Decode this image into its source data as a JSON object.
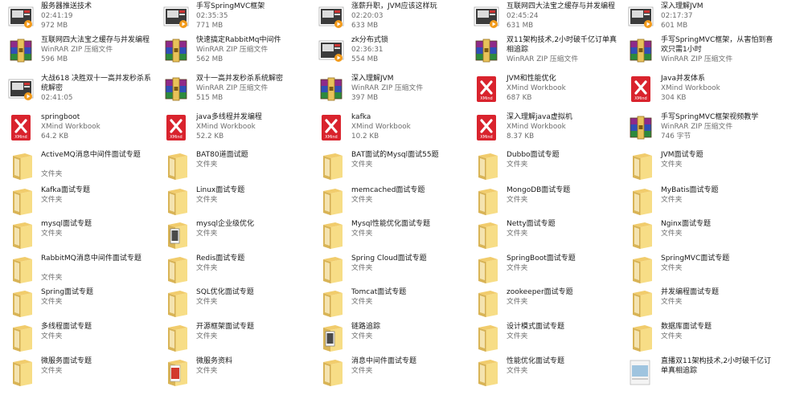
{
  "columns": [
    [
      {
        "name": "服务器推送技术",
        "lines": [
          "02:41:19",
          "972 MB"
        ],
        "icon": "video-file-icon"
      },
      {
        "name": "互联网四大法宝之缓存与并发编程",
        "lines": [
          "WinRAR ZIP 压缩文件",
          "596 MB"
        ],
        "icon": "winrar-archive-icon"
      },
      {
        "name": "大战618 决胜双十一高并发秒杀系统解密",
        "lines": [
          "02:41:05"
        ],
        "icon": "video-file-icon"
      },
      {
        "name": "springboot",
        "lines": [
          "XMind Workbook",
          "64.2 KB"
        ],
        "icon": "xmind-file-icon"
      },
      {
        "name": "ActiveMQ消息中间件面试专题",
        "lines": [
          "文件夹"
        ],
        "icon": "folder-icon"
      },
      {
        "name": "Kafka面试专题",
        "lines": [
          "文件夹"
        ],
        "icon": "folder-icon"
      },
      {
        "name": "mysql面试专题",
        "lines": [
          "文件夹"
        ],
        "icon": "folder-icon"
      },
      {
        "name": "RabbitMQ消息中间件面试专题",
        "lines": [
          "文件夹"
        ],
        "icon": "folder-icon"
      },
      {
        "name": "Spring面试专题",
        "lines": [
          "文件夹"
        ],
        "icon": "folder-icon"
      },
      {
        "name": "多线程面试专题",
        "lines": [
          "文件夹"
        ],
        "icon": "folder-icon"
      },
      {
        "name": "微服务面试专题",
        "lines": [
          "文件夹"
        ],
        "icon": "folder-icon"
      }
    ],
    [
      {
        "name": "手写SpringMVC框架",
        "lines": [
          "02:35:35",
          "771 MB"
        ],
        "icon": "video-file-icon"
      },
      {
        "name": "快速搞定RabbitMq中间件",
        "lines": [
          "WinRAR ZIP 压缩文件",
          "562 MB"
        ],
        "icon": "winrar-archive-icon"
      },
      {
        "name": "双十一高并发秒杀系统解密",
        "lines": [
          "WinRAR ZIP 压缩文件",
          "515 MB"
        ],
        "icon": "winrar-archive-icon"
      },
      {
        "name": "java多线程并发编程",
        "lines": [
          "XMind Workbook",
          "52.2 KB"
        ],
        "icon": "xmind-file-icon"
      },
      {
        "name": "BAT80道面试题",
        "lines": [
          "文件夹"
        ],
        "icon": "folder-icon"
      },
      {
        "name": "Linux面试专题",
        "lines": [
          "文件夹"
        ],
        "icon": "folder-icon"
      },
      {
        "name": "mysql企业级优化",
        "lines": [
          "文件夹"
        ],
        "icon": "folder-doc-icon"
      },
      {
        "name": "Redis面试专题",
        "lines": [
          "文件夹"
        ],
        "icon": "folder-icon"
      },
      {
        "name": "SQL优化面试专题",
        "lines": [
          "文件夹"
        ],
        "icon": "folder-icon"
      },
      {
        "name": "开源框架面试专题",
        "lines": [
          "文件夹"
        ],
        "icon": "folder-icon"
      },
      {
        "name": "微服务资料",
        "lines": [
          "文件夹"
        ],
        "icon": "folder-red-icon"
      }
    ],
    [
      {
        "name": "涨薪升职，JVM应该这样玩",
        "lines": [
          "02:20:03",
          "633 MB"
        ],
        "icon": "video-file-icon"
      },
      {
        "name": "zk分布式锁",
        "lines": [
          "02:36:31",
          "554 MB"
        ],
        "icon": "video-file-icon"
      },
      {
        "name": "深入理解JVM",
        "lines": [
          "WinRAR ZIP 压缩文件",
          "397 MB"
        ],
        "icon": "winrar-archive-icon"
      },
      {
        "name": "kafka",
        "lines": [
          "XMind Workbook",
          "10.2 KB"
        ],
        "icon": "xmind-file-icon"
      },
      {
        "name": "BAT面试的Mysql面试55题",
        "lines": [
          "文件夹"
        ],
        "icon": "folder-icon"
      },
      {
        "name": "memcached面试专题",
        "lines": [
          "文件夹"
        ],
        "icon": "folder-icon"
      },
      {
        "name": "Mysql性能优化面试专题",
        "lines": [
          "文件夹"
        ],
        "icon": "folder-icon"
      },
      {
        "name": "Spring Cloud面试专题",
        "lines": [
          "文件夹"
        ],
        "icon": "folder-icon"
      },
      {
        "name": "Tomcat面试专题",
        "lines": [
          "文件夹"
        ],
        "icon": "folder-icon"
      },
      {
        "name": "链路追踪",
        "lines": [
          "文件夹"
        ],
        "icon": "folder-doc-icon"
      },
      {
        "name": "消息中间件面试专题",
        "lines": [
          "文件夹"
        ],
        "icon": "folder-icon"
      }
    ],
    [
      {
        "name": "互联网四大法宝之缓存与并发编程",
        "lines": [
          "02:45:24",
          "631 MB"
        ],
        "icon": "video-file-icon"
      },
      {
        "name": "双11架构技术,2小时破千亿订单真相追踪",
        "lines": [
          "WinRAR ZIP 压缩文件"
        ],
        "icon": "winrar-archive-icon"
      },
      {
        "name": "JVM和性能优化",
        "lines": [
          "XMind Workbook",
          "687 KB"
        ],
        "icon": "xmind-file-icon"
      },
      {
        "name": "深入理解java虚拟机",
        "lines": [
          "XMind Workbook",
          "8.37 KB"
        ],
        "icon": "xmind-file-icon"
      },
      {
        "name": "Dubbo面试专题",
        "lines": [
          "文件夹"
        ],
        "icon": "folder-icon"
      },
      {
        "name": "MongoDB面试专题",
        "lines": [
          "文件夹"
        ],
        "icon": "folder-icon"
      },
      {
        "name": "Netty面试专题",
        "lines": [
          "文件夹"
        ],
        "icon": "folder-icon"
      },
      {
        "name": "SpringBoot面试专题",
        "lines": [
          "文件夹"
        ],
        "icon": "folder-icon"
      },
      {
        "name": "zookeeper面试专题",
        "lines": [
          "文件夹"
        ],
        "icon": "folder-icon"
      },
      {
        "name": "设计模式面试专题",
        "lines": [
          "文件夹"
        ],
        "icon": "folder-icon"
      },
      {
        "name": "性能优化面试专题",
        "lines": [
          "文件夹"
        ],
        "icon": "folder-icon"
      }
    ],
    [
      {
        "name": "深入理解JVM",
        "lines": [
          "02:17:37",
          "601 MB"
        ],
        "icon": "video-file-icon"
      },
      {
        "name": "手写SpringMVC框架，从害怕到喜欢只需1小时",
        "lines": [
          "WinRAR ZIP 压缩文件"
        ],
        "icon": "winrar-archive-icon"
      },
      {
        "name": "Java并发体系",
        "lines": [
          "XMind Workbook",
          "304 KB"
        ],
        "icon": "xmind-file-icon"
      },
      {
        "name": "手写SpringMVC框架视频教学",
        "lines": [
          "WinRAR ZIP 压缩文件",
          "746 字节"
        ],
        "icon": "winrar-archive-icon"
      },
      {
        "name": "JVM面试专题",
        "lines": [
          "文件夹"
        ],
        "icon": "folder-icon"
      },
      {
        "name": "MyBatis面试专题",
        "lines": [
          "文件夹"
        ],
        "icon": "folder-icon"
      },
      {
        "name": "Nginx面试专题",
        "lines": [
          "文件夹"
        ],
        "icon": "folder-icon"
      },
      {
        "name": "SpringMVC面试专题",
        "lines": [
          "文件夹"
        ],
        "icon": "folder-icon"
      },
      {
        "name": "并发编程面试专题",
        "lines": [
          "文件夹"
        ],
        "icon": "folder-icon"
      },
      {
        "name": "数据库面试专题",
        "lines": [
          "文件夹"
        ],
        "icon": "folder-icon"
      },
      {
        "name": "直播双11架构技术,2小时破千亿订单真相追踪",
        "lines": [],
        "icon": "video-thumbnail-icon"
      }
    ]
  ]
}
